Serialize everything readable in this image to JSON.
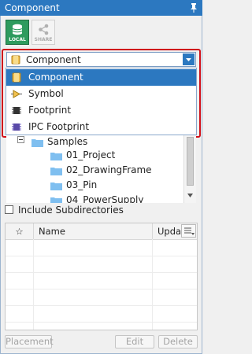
{
  "panel": {
    "title": "Component",
    "pin_icon": "pin-icon"
  },
  "toolbar": {
    "local_label": "LOCAL",
    "share_label": "SHARE"
  },
  "type_select": {
    "selected": "Component",
    "options": [
      {
        "label": "Component",
        "icon": "component-icon",
        "selected": true
      },
      {
        "label": "Symbol",
        "icon": "symbol-icon"
      },
      {
        "label": "Footprint",
        "icon": "footprint-icon"
      },
      {
        "label": "IPC Footprint",
        "icon": "ipc-footprint-icon"
      }
    ]
  },
  "tree": {
    "items": [
      {
        "label": "Samples",
        "expanded": true
      },
      {
        "label": "01_Project"
      },
      {
        "label": "02_DrawingFrame"
      },
      {
        "label": "03_Pin"
      },
      {
        "label": "04_PowerSupply"
      }
    ]
  },
  "include_subdirectories": {
    "label": "Include Subdirectories",
    "checked": false
  },
  "grid": {
    "columns": [
      "☆",
      "Name",
      "Updat"
    ]
  },
  "buttons": {
    "placement": "Placement",
    "edit": "Edit",
    "delete": "Delete"
  },
  "colors": {
    "accent": "#2c78c0",
    "highlight_frame": "#d0121b",
    "local_button": "#2e9b5e"
  }
}
